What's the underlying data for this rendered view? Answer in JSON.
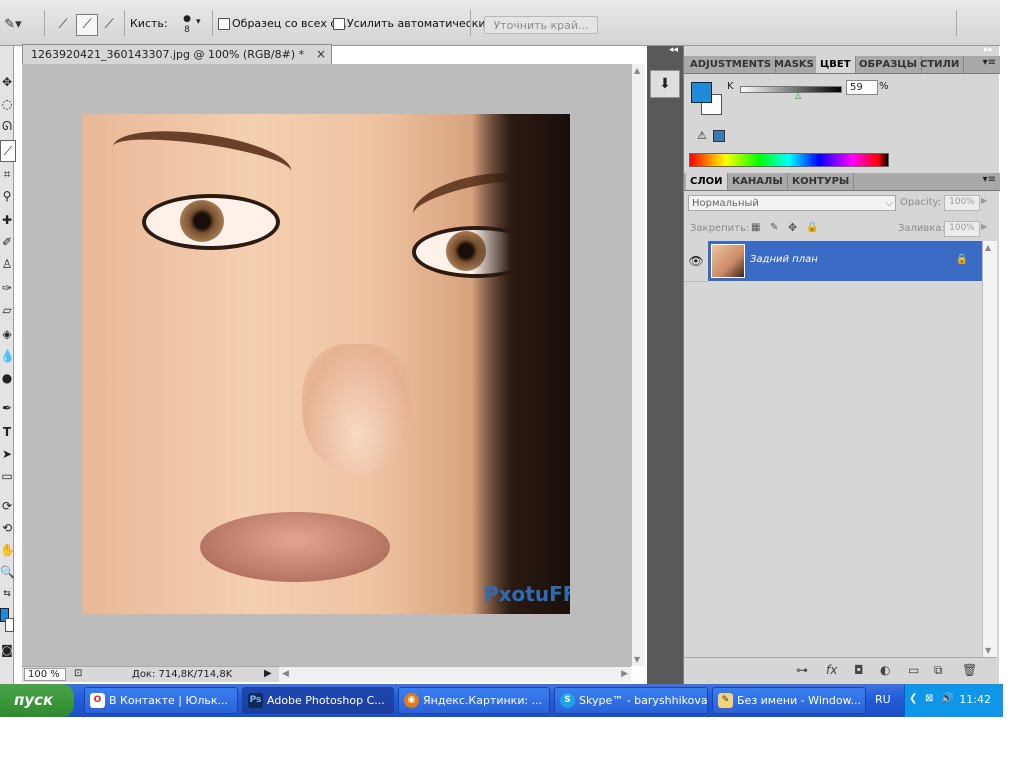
{
  "options_bar": {
    "brush_label": "Кисть:",
    "brush_size": "8",
    "sample_all_label": "Образец со всех сл.",
    "auto_enhance_label": "Усилить автоматически",
    "refine_edge_label": "Уточнить край..."
  },
  "document": {
    "tab_title": "1263920421_360143307.jpg @ 100% (RGB/8#) *",
    "watermark": "PxotuFF",
    "zoom": "100 %",
    "doc_size": "Док: 714,8K/714,8K"
  },
  "color_panel": {
    "tabs": [
      "ADJUSTMENTS",
      "MASKS",
      "ЦВЕТ",
      "ОБРАЗЦЫ",
      "СТИЛИ"
    ],
    "active_tab": "ЦВЕТ",
    "channel_label": "K",
    "channel_value": "59",
    "percent": "%",
    "foreground_color": "#1f8ad8"
  },
  "layers_panel": {
    "tabs": [
      "СЛОИ",
      "КАНАЛЫ",
      "КОНТУРЫ"
    ],
    "active_tab": "СЛОИ",
    "blend_mode": "Нормальный",
    "opacity_label": "Opacity:",
    "opacity_value": "100%",
    "lock_label": "Закрепить:",
    "fill_label": "Заливка:",
    "fill_value": "100%",
    "layer_name": "Задний план"
  },
  "taskbar": {
    "start_label": "пуск",
    "tasks": [
      {
        "label": "В Контакте | Юльк...",
        "icon": "opera-icon"
      },
      {
        "label": "Adobe Photoshop C...",
        "icon": "photoshop-icon"
      },
      {
        "label": "Яндекс.Картинки: ...",
        "icon": "firefox-icon"
      },
      {
        "label": "Skype™ - baryshhikova",
        "icon": "skype-icon"
      },
      {
        "label": "Без имени - Window...",
        "icon": "paint-icon"
      }
    ],
    "language": "RU",
    "clock": "11:42"
  }
}
